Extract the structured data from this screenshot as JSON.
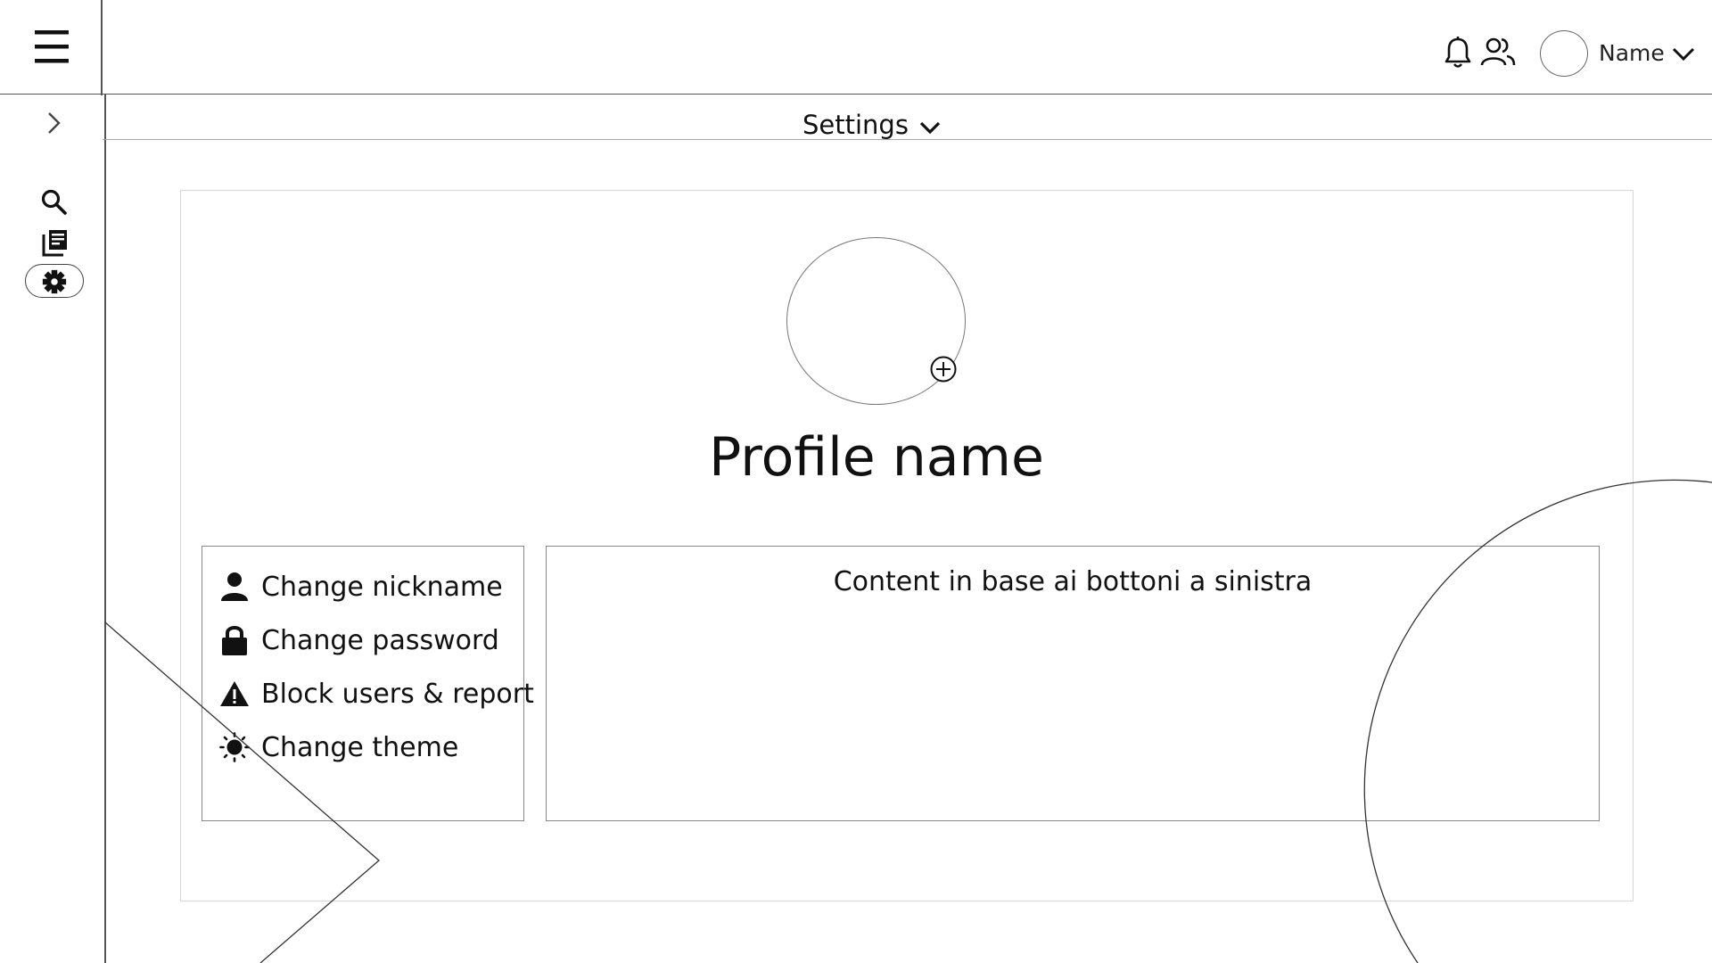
{
  "header": {
    "user_name": "Name",
    "icons": [
      "menu-icon",
      "bell-icon",
      "users-icon",
      "chevron-down-icon"
    ]
  },
  "sidebar": {
    "items": [
      {
        "icon": "search-icon",
        "active": false
      },
      {
        "icon": "library-icon",
        "active": false
      },
      {
        "icon": "gear-icon",
        "active": true
      }
    ]
  },
  "settings_bar": {
    "title": "Settings"
  },
  "profile": {
    "name": "Profile name"
  },
  "options": [
    {
      "label": "Change nickname",
      "icon": "user-icon"
    },
    {
      "label": "Change password",
      "icon": "lock-icon"
    },
    {
      "label": "Block users & report",
      "icon": "warning-icon"
    },
    {
      "label": "Change theme",
      "icon": "sun-icon"
    }
  ],
  "content": {
    "text": "Content in base ai bottoni a sinistra"
  }
}
